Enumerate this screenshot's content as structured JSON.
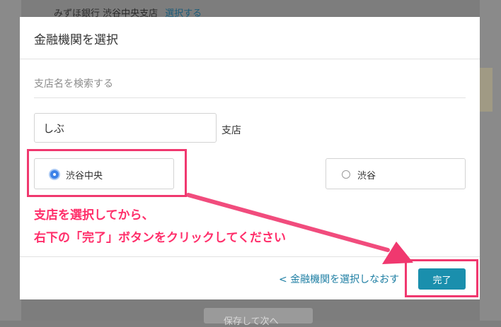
{
  "background": {
    "top_text": "みずほ銀行 渋谷中央支店",
    "top_link": "選択する",
    "bottom_button": "保存して次へ"
  },
  "modal": {
    "title": "金融機関を選択",
    "section_label": "支店名を検索する",
    "search_value": "しぶ",
    "input_suffix": "支店",
    "options": [
      {
        "label": "渋谷中央",
        "selected": true
      },
      {
        "label": "渋谷",
        "selected": false
      }
    ],
    "back_link": "< 金融機関を選択しなおす",
    "done_label": "完了"
  },
  "annotation": {
    "line1": "支店を選択してから、",
    "line2": "右下の「完了」ボタンをクリックしてください",
    "color": "#f0386f"
  },
  "colors": {
    "primary_button": "#1a8fad",
    "link": "#1d7ea3",
    "radio_selected": "#3d82e8"
  }
}
